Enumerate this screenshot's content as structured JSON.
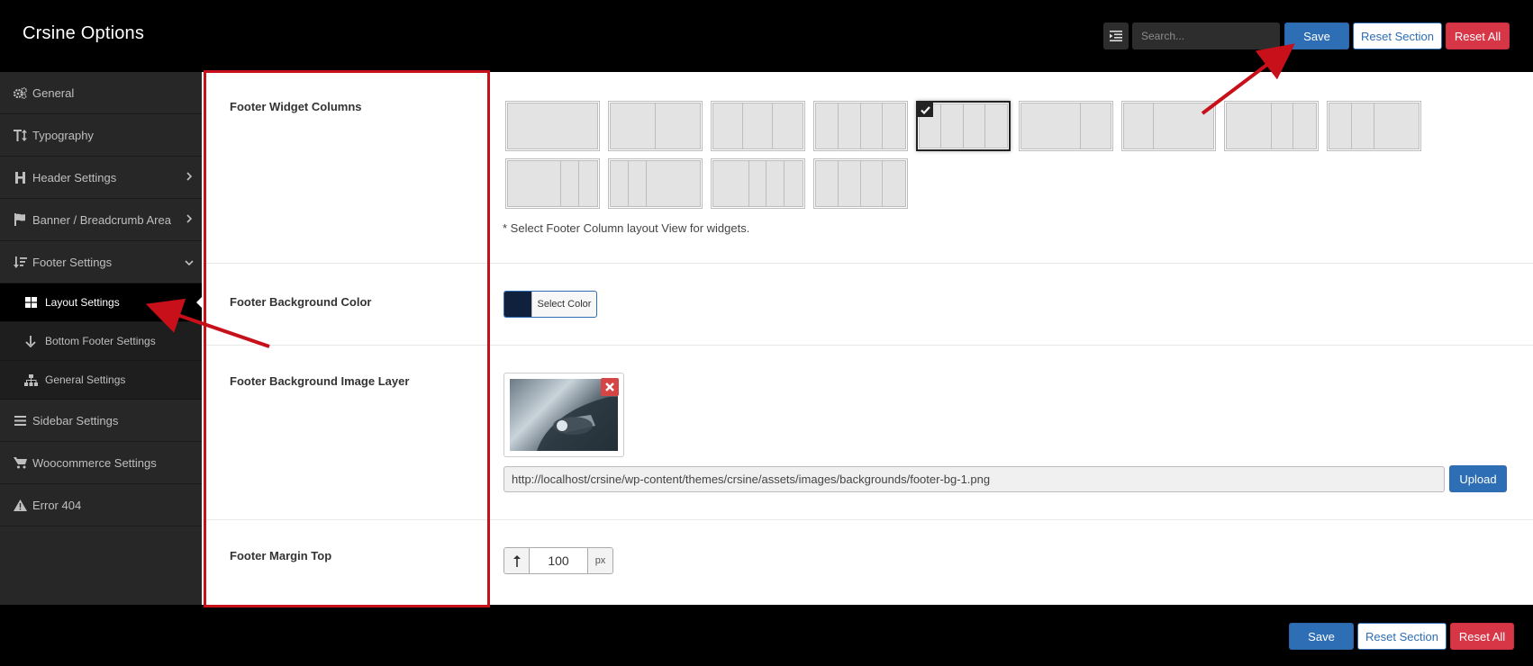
{
  "header": {
    "title": "Crsine Options",
    "search_placeholder": "Search...",
    "save_label": "Save",
    "reset_section_label": "Reset Section",
    "reset_all_label": "Reset All"
  },
  "sidebar": {
    "items": [
      {
        "label": "General",
        "icon": "gears-icon"
      },
      {
        "label": "Typography",
        "icon": "text-height-icon"
      },
      {
        "label": "Header Settings",
        "icon": "heading-icon",
        "expandable": true
      },
      {
        "label": "Banner / Breadcrumb Area",
        "icon": "flag-icon",
        "expandable": true
      },
      {
        "label": "Footer Settings",
        "icon": "sort-icon",
        "expanded": true
      },
      {
        "label": "Sidebar Settings",
        "icon": "bars-icon"
      },
      {
        "label": "Woocommerce Settings",
        "icon": "cart-icon"
      },
      {
        "label": "Error 404",
        "icon": "warning-icon"
      }
    ],
    "footer_subitems": [
      {
        "label": "Layout Settings",
        "icon": "grid-icon",
        "active": true
      },
      {
        "label": "Bottom Footer Settings",
        "icon": "arrow-down-icon"
      },
      {
        "label": "General Settings",
        "icon": "sitemap-icon"
      }
    ]
  },
  "main": {
    "widget_columns": {
      "label": "Footer Widget Columns",
      "hint": "* Select Footer Column layout View for widgets.",
      "selected_index": 4,
      "layouts": [
        [
          1
        ],
        [
          1,
          1
        ],
        [
          1,
          1,
          1
        ],
        [
          1,
          1,
          1,
          1
        ]
      ]
    },
    "bg_color": {
      "label": "Footer Background Color",
      "button_label": "Select Color",
      "value": "#0f213c"
    },
    "bg_image": {
      "label": "Footer Background Image Layer",
      "url": "http://localhost/crsine/wp-content/themes/crsine/assets/images/backgrounds/footer-bg-1.png",
      "upload_label": "Upload"
    },
    "margin_top": {
      "label": "Footer Margin Top",
      "value": "100",
      "unit": "px"
    }
  },
  "footer": {
    "save_label": "Save",
    "reset_section_label": "Reset Section",
    "reset_all_label": "Reset All"
  },
  "colors": {
    "primary": "#2e6eb4",
    "danger": "#d63646",
    "annotation": "#c8101a"
  }
}
